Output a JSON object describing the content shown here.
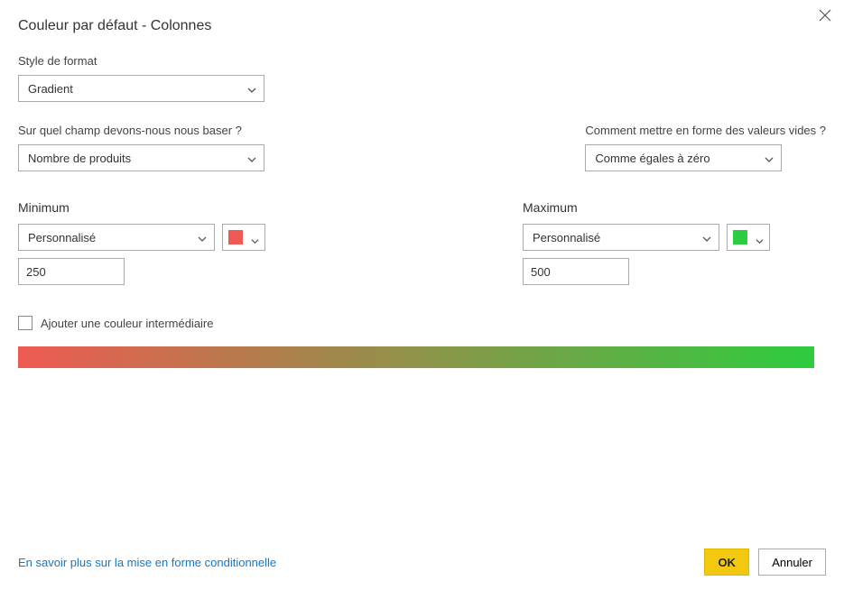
{
  "title": "Couleur par défaut - Colonnes",
  "close_icon": "close-icon",
  "format_style": {
    "label": "Style de format",
    "value": "Gradient"
  },
  "field_basis": {
    "label": "Sur quel champ devons-nous nous baser ?",
    "value": "Nombre de produits"
  },
  "empty_values": {
    "label": "Comment mettre en forme des valeurs vides ?",
    "value": "Comme égales à zéro"
  },
  "minimum": {
    "label": "Minimum",
    "mode": "Personnalisé",
    "color": "#ee5a52",
    "value": "250"
  },
  "maximum": {
    "label": "Maximum",
    "mode": "Personnalisé",
    "color": "#2ecc40",
    "value": "500"
  },
  "intermediate": {
    "label": "Ajouter une couleur intermédiaire"
  },
  "gradient": {
    "from": "#ee5a52",
    "to": "#2ecc40"
  },
  "footer": {
    "link": "En savoir plus sur la mise en forme conditionnelle",
    "ok": "OK",
    "cancel": "Annuler"
  }
}
